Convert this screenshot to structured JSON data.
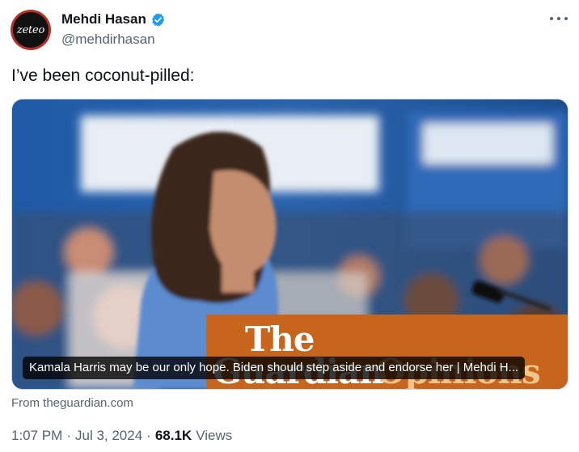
{
  "author": {
    "avatar_text": "zeteo",
    "display_name": "Mehdi Hasan",
    "handle": "@mehdirhasan",
    "verified_icon": "verified-badge-icon",
    "verified_color": "#1d9bf0"
  },
  "tweet": {
    "text": "I’ve been coconut-pilled:"
  },
  "card": {
    "brand_the": "The",
    "brand_guardian": "Guardian",
    "brand_opinions": "Opinions",
    "brand_color": "#c8651c",
    "caption": "Kamala Harris may be our only hope. Biden should step aside and endorse her | Mehdi H...",
    "source": "From theguardian.com"
  },
  "meta": {
    "time": "1:07 PM",
    "sep1": "·",
    "date": "Jul 3, 2024",
    "sep2": "·",
    "views_count": "68.1K",
    "views_label": "Views"
  },
  "more_icon": "more-horizontal-icon"
}
